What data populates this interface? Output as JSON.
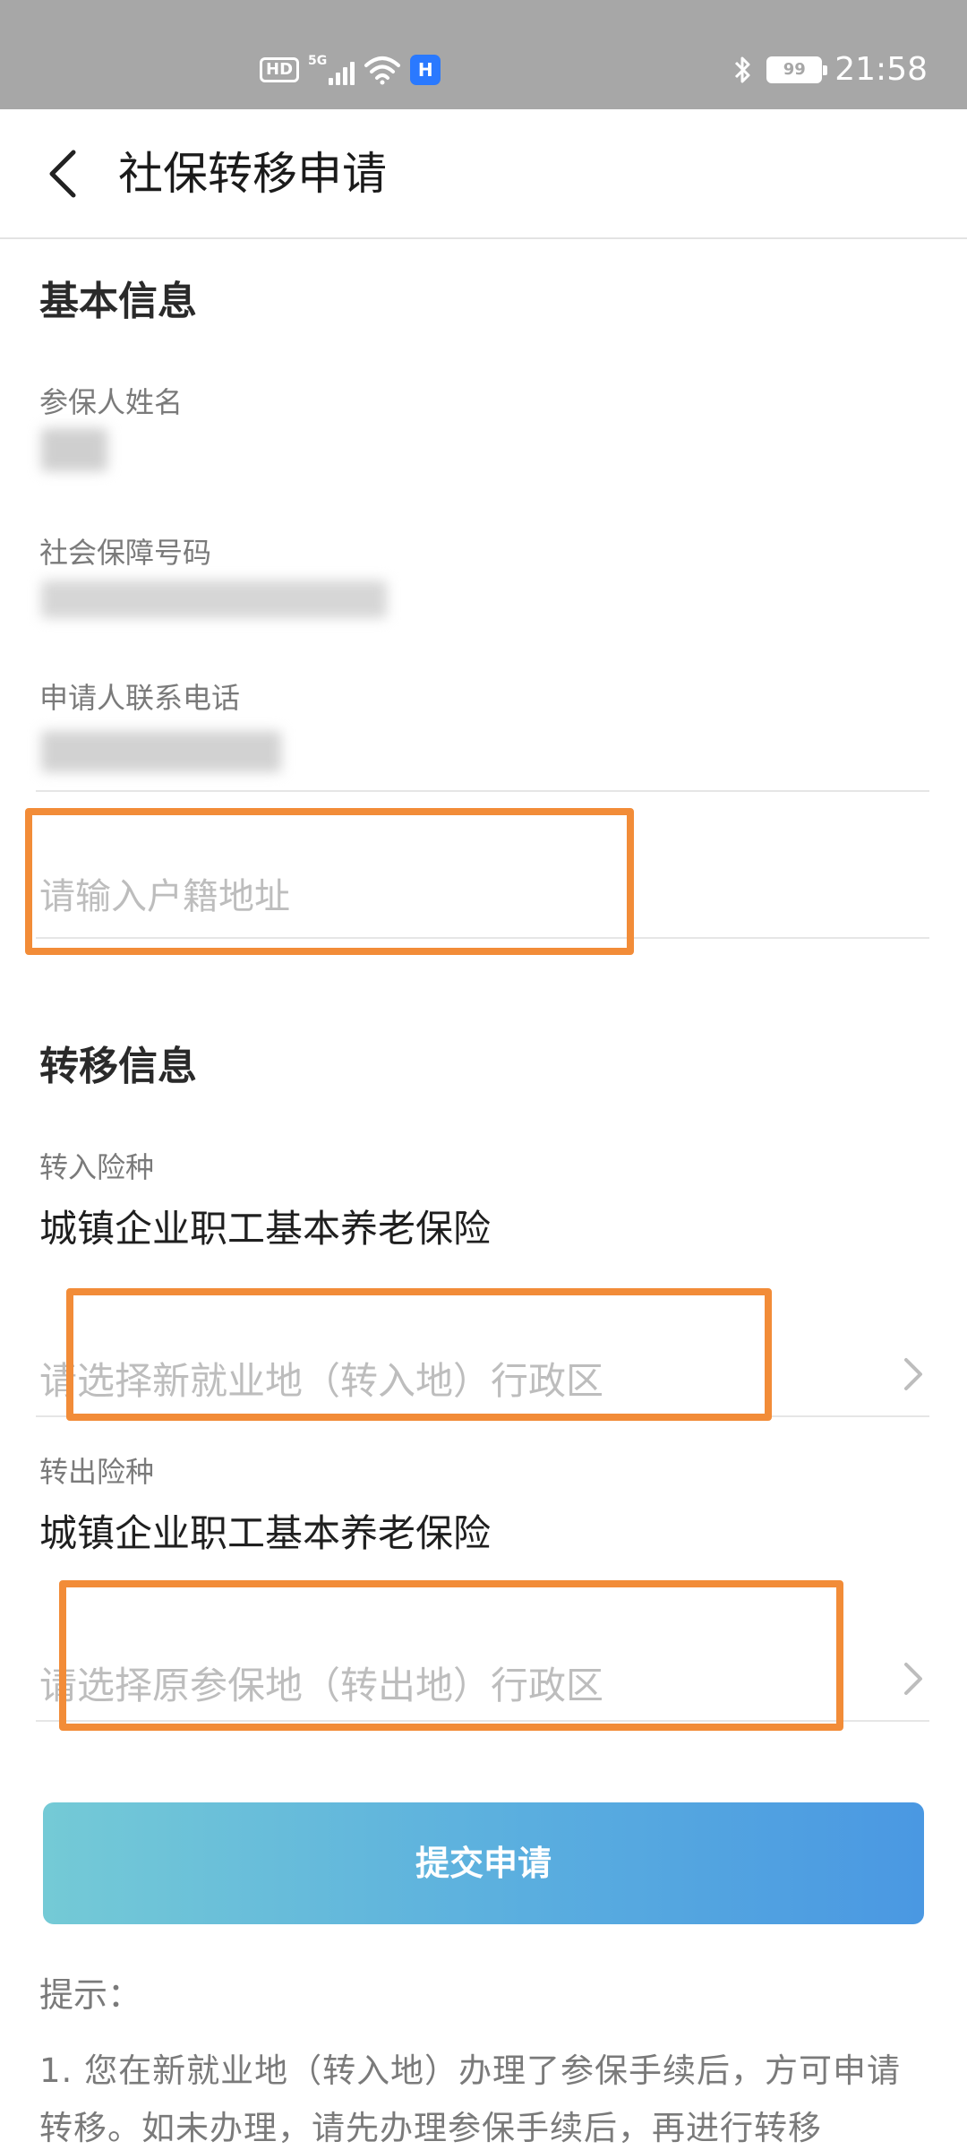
{
  "status_bar": {
    "hd": "HD",
    "network": "5G",
    "app_badge": "H",
    "battery": "99",
    "time": "21:58"
  },
  "header": {
    "title": "社保转移申请"
  },
  "basic_info": {
    "section_title": "基本信息",
    "name_label": "参保人姓名",
    "ssn_label": "社会保障号码",
    "phone_label": "申请人联系电话",
    "address_placeholder": "请输入户籍地址"
  },
  "transfer_info": {
    "section_title": "转移信息",
    "in_type_label": "转入险种",
    "in_type_value": "城镇企业职工基本养老保险",
    "in_region_placeholder": "请选择新就业地（转入地）行政区",
    "out_type_label": "转出险种",
    "out_type_value": "城镇企业职工基本养老保险",
    "out_region_placeholder": "请选择原参保地（转出地）行政区"
  },
  "submit_label": "提交申请",
  "tips": {
    "title": "提示：",
    "body": "1. 您在新就业地（转入地）办理了参保手续后，方可申请转移。如未办理，请先办理参保手续后，再进行转移"
  },
  "colors": {
    "highlight": "#f28c38",
    "button_start": "#74cad6",
    "button_end": "#4a98e2"
  }
}
